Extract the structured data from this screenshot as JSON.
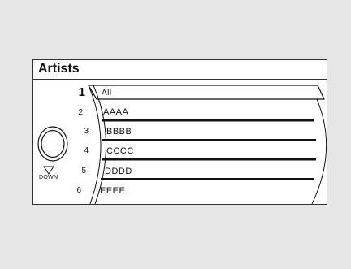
{
  "screen": {
    "title": "Artists",
    "knob": {
      "icon": "rotary-knob-icon",
      "down_icon": "triangle-down-icon",
      "down_label": "DOWN"
    },
    "items": [
      {
        "number": "1",
        "label": "All"
      },
      {
        "number": "2",
        "label": "AAAA"
      },
      {
        "number": "3",
        "label": "BBBB"
      },
      {
        "number": "4",
        "label": "CCCC"
      },
      {
        "number": "5",
        "label": "DDDD"
      },
      {
        "number": "6",
        "label": "EEEE"
      }
    ]
  }
}
